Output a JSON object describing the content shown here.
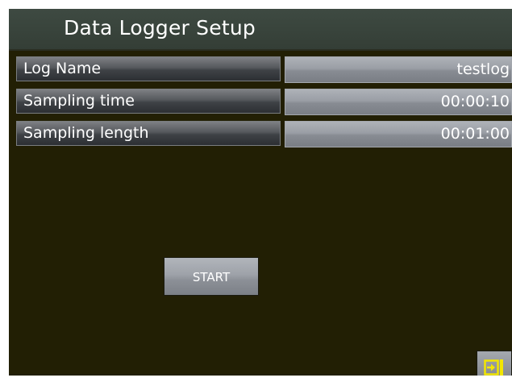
{
  "header": {
    "title": "Data Logger Setup"
  },
  "settings": {
    "rows": [
      {
        "label": "Log Name",
        "value": "testlog"
      },
      {
        "label": "Sampling time",
        "value": "00:00:10"
      },
      {
        "label": "Sampling length",
        "value": "00:01:00"
      }
    ]
  },
  "actions": {
    "start_label": "START",
    "exit_icon": "exit-arrow-icon"
  },
  "colors": {
    "background": "#221f04",
    "titlebar": "#3e4a42",
    "exit_icon": "#f2e600"
  }
}
